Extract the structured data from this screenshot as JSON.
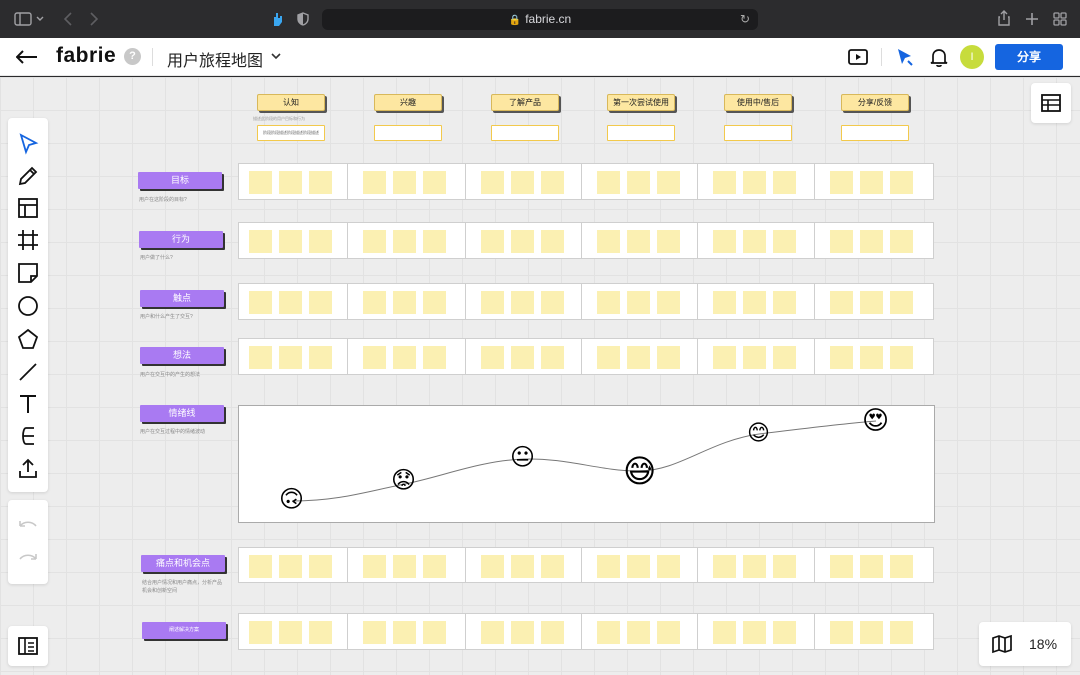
{
  "browser": {
    "url": "fabrie.cn",
    "icons": [
      "sidebar-toggle-icon",
      "back-arrow-icon",
      "forward-arrow-icon",
      "hand-extension-icon",
      "shield-icon",
      "lock-icon",
      "reload-icon",
      "share-icon",
      "new-tab-icon",
      "tab-overview-icon"
    ]
  },
  "header": {
    "logo": "fabrie",
    "help": "?",
    "title": "用户旅程地图",
    "avatar_initial": "I",
    "share_label": "分享",
    "icons": [
      "back-icon",
      "present-icon",
      "cursor-icon",
      "bell-icon"
    ],
    "accent": "#1565e0"
  },
  "toolbar": {
    "tools": [
      "select-icon",
      "pen-icon",
      "template-icon",
      "frame-icon",
      "sticky-note-icon",
      "circle-icon",
      "polygon-icon",
      "line-icon",
      "text-icon",
      "connector-icon",
      "upload-icon"
    ],
    "history": [
      "undo-icon",
      "redo-icon"
    ],
    "bottom": "layers-panel-icon"
  },
  "right_panel": {
    "icon": "table-icon"
  },
  "zoom": {
    "icon": "map-icon",
    "value": "18%"
  },
  "stages": [
    {
      "label": "认知",
      "box_text": "阶段阶段描述阶段描述阶段描述"
    },
    {
      "label": "兴趣",
      "box_text": ""
    },
    {
      "label": "了解产品",
      "box_text": ""
    },
    {
      "label": "第一次尝试使用",
      "box_text": ""
    },
    {
      "label": "使用中/售后",
      "box_text": ""
    },
    {
      "label": "分享/反馈",
      "box_text": ""
    }
  ],
  "stage_hint": "描述此阶段的用户目标和行为",
  "rows": [
    {
      "label": "目标",
      "desc": "用户在这阶段的目标?"
    },
    {
      "label": "行为",
      "desc": "用户做了什么?"
    },
    {
      "label": "触点",
      "desc": "用户和什么产生了交互?"
    },
    {
      "label": "想法",
      "desc": "用户在交互中的产生的想法"
    },
    {
      "label": "情绪线",
      "desc": "用户在交互过程中的情绪波动"
    },
    {
      "label": "痛点和机会点",
      "desc": "结合用户情况和用户痛点，分析产品",
      "desc2": "机会和创新空间"
    },
    {
      "label": "阐述解决方案",
      "desc": ""
    }
  ],
  "emotion_curve": {
    "points": [
      {
        "stage": "认知",
        "emoji": "🙃"
      },
      {
        "stage": "兴趣",
        "emoji": "😟"
      },
      {
        "stage": "了解产品",
        "emoji": "😐"
      },
      {
        "stage": "第一次尝试使用",
        "emoji": "😅"
      },
      {
        "stage": "使用中/售后",
        "emoji": "😊"
      },
      {
        "stage": "分享/反馈",
        "emoji": "😍"
      }
    ]
  },
  "colors": {
    "stage_fill": "#fde7a1",
    "row_label": "#a97af2",
    "sticky": "#fbf0b2"
  }
}
